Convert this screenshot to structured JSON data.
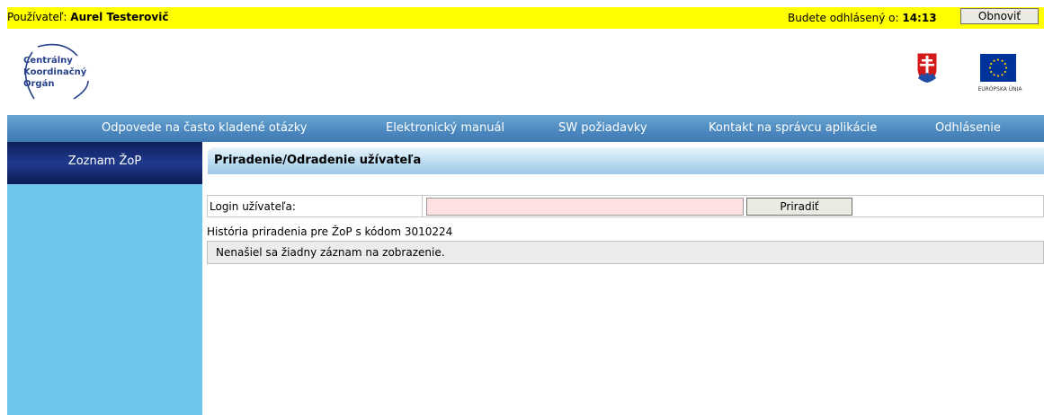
{
  "topbar": {
    "user_prefix": "Používateľ: ",
    "user_name": "Aurel Testerovič",
    "logout_prefix": "Budete odhlásený o: ",
    "logout_time": "14:13",
    "refresh_label": "Obnoviť"
  },
  "header": {
    "logo_lines": [
      "Centrálny",
      "Koordinačný",
      "Orgán"
    ],
    "eu_caption": "EURÓPSKA ÚNIA"
  },
  "nav": {
    "items": [
      {
        "label": "Odpovede na často kladené otázky"
      },
      {
        "label": "Elektronický manuál"
      },
      {
        "label": "SW požiadavky"
      },
      {
        "label": "Kontakt na správcu aplikácie"
      },
      {
        "label": "Odhlásenie"
      }
    ]
  },
  "sidebar": {
    "items": [
      {
        "label": "Zoznam ŽoP"
      }
    ]
  },
  "main": {
    "title": "Priradenie/Odradenie užívateľa",
    "login_label": "Login užívateľa:",
    "login_value": "",
    "assign_label": "Priradiť",
    "history_text": "História priradenia pre ŽoP s kódom 3010224",
    "empty_message": "Nenašiel sa žiadny záznam na zobrazenie."
  },
  "colors": {
    "topbar_bg": "#ffff00",
    "nav_bg": "#4d8ac0",
    "sidebar_bg": "#6ec6ef",
    "sidebar_head_bg": "#1f3a8c",
    "input_bg": "#fde0e0"
  }
}
